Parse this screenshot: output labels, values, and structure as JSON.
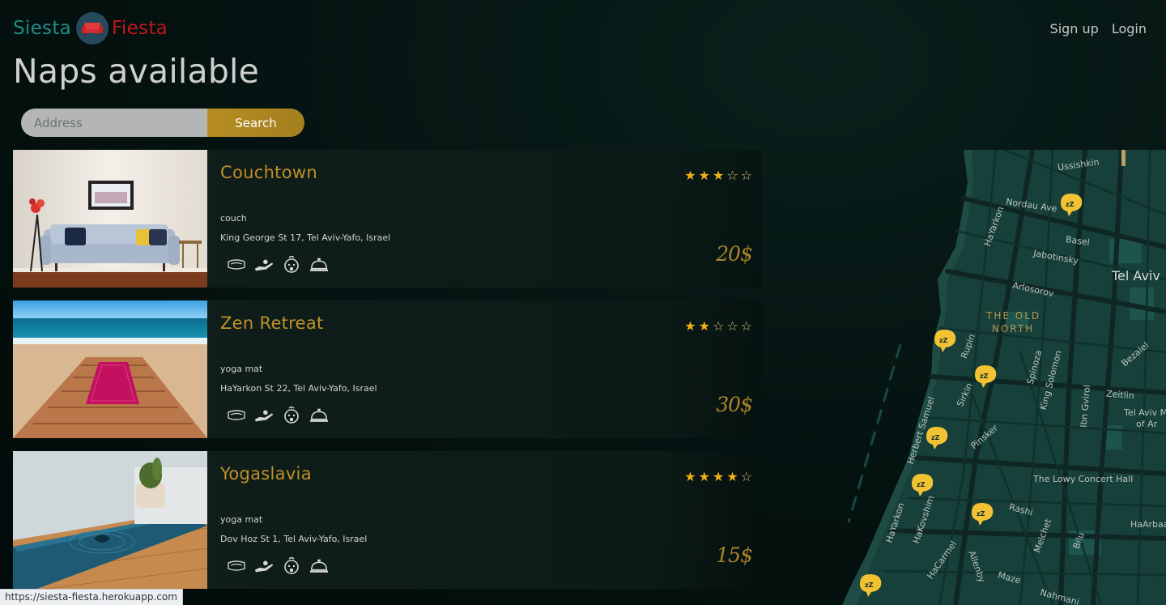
{
  "header": {
    "brand_part1": "Siesta",
    "brand_part2": "Fiesta",
    "nav": [
      {
        "label": "Sign up"
      },
      {
        "label": "Login"
      }
    ]
  },
  "page_title": "Naps available",
  "search": {
    "placeholder": "Address",
    "button_label": "Search"
  },
  "listings": [
    {
      "title": "Couchtown",
      "type": "couch",
      "address": "King George St 17, Tel Aviv-Yafo, Israel",
      "rating": 3,
      "max_rating": 5,
      "price": "20$",
      "amenities": [
        "bed-icon",
        "hand-icon",
        "baby-icon",
        "service-bell-icon"
      ]
    },
    {
      "title": "Zen Retreat",
      "type": "yoga mat",
      "address": "HaYarkon St 22, Tel Aviv-Yafo, Israel",
      "rating": 2,
      "max_rating": 5,
      "price": "30$",
      "amenities": [
        "bed-icon",
        "hand-icon",
        "baby-icon",
        "service-bell-icon"
      ]
    },
    {
      "title": "Yogaslavia",
      "type": "yoga mat",
      "address": "Dov Hoz St 1, Tel Aviv-Yafo, Israel",
      "rating": 4,
      "max_rating": 5,
      "price": "15$",
      "amenities": [
        "bed-icon",
        "hand-icon",
        "baby-icon",
        "service-bell-icon"
      ]
    }
  ],
  "map": {
    "labels": {
      "ussishkin": "Ussishkin",
      "nordau": "Nordau Ave",
      "hayarkon_top": "HaYarkon",
      "basel": "Basel",
      "jabotinsky": "Jabotinsky",
      "tel_aviv": "Tel Aviv",
      "arlosorov": "Arlosorov",
      "old_north_1": "THE OLD",
      "old_north_2": "NORTH",
      "rupin": "Rupin",
      "bezalel": "Bezalel",
      "spinoza": "Spinoza",
      "king_solomon": "King Solomon",
      "zeitlin": "Zeitlin",
      "ibn_gvirol": "Ibn Gvirol",
      "sirkin": "Sirkin",
      "tel_aviv_m_1": "Tel Aviv M",
      "tel_aviv_m_2": "of Ar",
      "herbert_samuel": "Herbert Samuel",
      "pinsker": "Pinsker",
      "lowy": "The Lowy Concert Hall",
      "hayarkon_bottom": "HaYarkon",
      "hakovshim": "HaKovshim",
      "rashi": "Rashi",
      "melchet": "Melchet",
      "bilu": "Bilu",
      "haarbaa": "HaArbaa",
      "hacarmel": "HaCarmel",
      "allenby": "Allenby",
      "maze": "Maze",
      "nahmani": "Nahmani"
    },
    "marker_count": 7,
    "colors": {
      "land": "#17403a",
      "road": "#0f2624",
      "water": "#03100e",
      "marker": "#f2c233"
    }
  },
  "status_url": "https://siesta-fiesta.herokuapp.com",
  "colors": {
    "accent_gold": "#c09025",
    "brand_teal": "#1f8b86",
    "brand_red": "#c0151f"
  }
}
